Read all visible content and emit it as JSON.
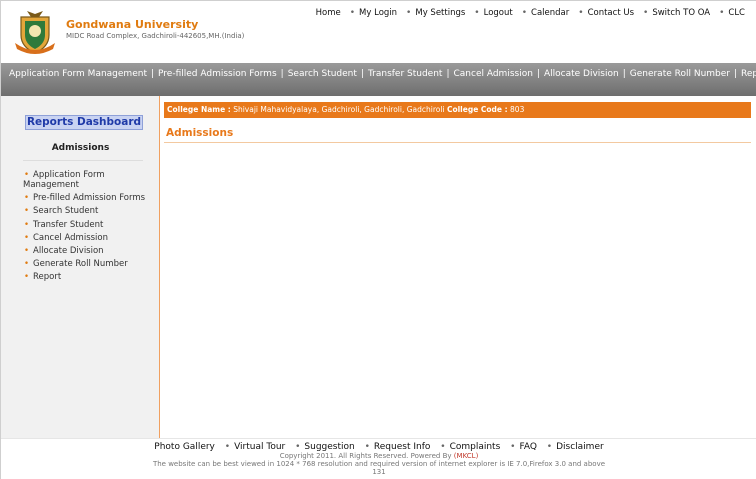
{
  "header": {
    "university_name": "Gondwana University",
    "address": "MIDC Road Complex, Gadchiroli-442605,MH.(India)",
    "top_links": [
      "Home",
      "My Login",
      "My Settings",
      "Logout",
      "Calendar",
      "Contact Us",
      "Switch TO OA",
      "CLC"
    ]
  },
  "navbar": {
    "items": [
      "Application Form Management",
      "Pre-filled Admission Forms",
      "Search Student",
      "Transfer Student",
      "Cancel Admission",
      "Allocate Division",
      "Generate Roll Number",
      "Report"
    ]
  },
  "sidebar": {
    "dashboard_button": "Reports Dashboard",
    "section_title": "Admissions",
    "items": [
      "Application Form Management",
      "Pre-filled Admission Forms",
      "Search Student",
      "Transfer Student",
      "Cancel Admission",
      "Allocate Division",
      "Generate Roll Number",
      "Report"
    ]
  },
  "main": {
    "college_name_label": "College Name :",
    "college_name_value": "Shivaji Mahavidyalaya, Gadchiroli, Gadchiroli, Gadchiroli",
    "college_code_label": "College Code :",
    "college_code_value": "803",
    "section_title": "Admissions"
  },
  "footer": {
    "links": [
      "Photo Gallery",
      "Virtual Tour",
      "Suggestion",
      "Request Info",
      "Complaints",
      "FAQ",
      "Disclaimer"
    ],
    "copyright_prefix": "Copyright 2011. All Rights Reserved. Powered By",
    "powered_by": "(MKCL)",
    "browser_note": "The website can be best viewed in 1024 * 768 resolution and required version of internet explorer is IE 7.0,Firefox 3.0 and above",
    "page_number": "131"
  },
  "colors": {
    "accent": "#e8791b",
    "navbar": "#808080",
    "dashboard_button": "#c9d3f2",
    "dashboard_text": "#1f3aa8"
  }
}
